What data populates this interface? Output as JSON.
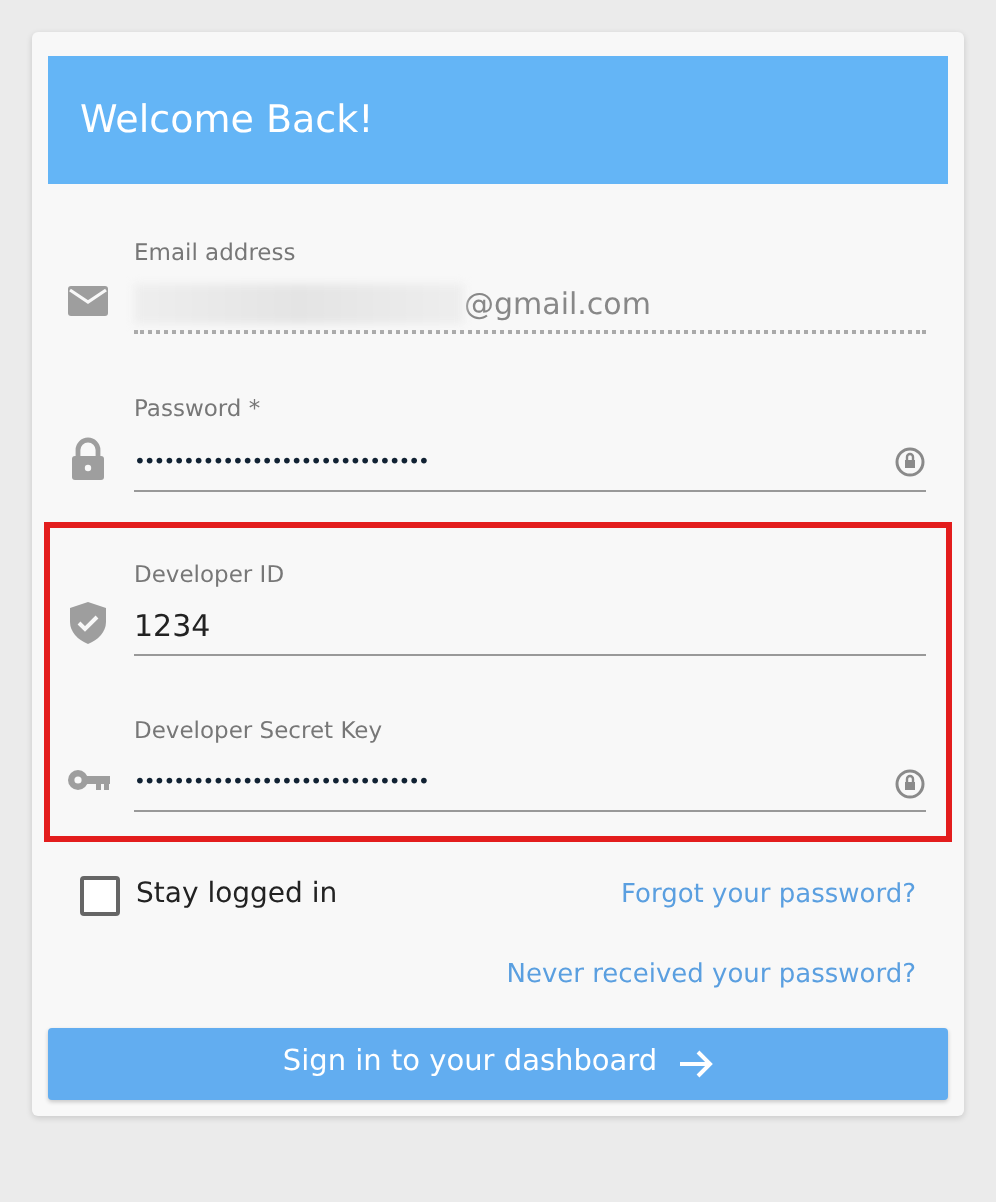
{
  "header": {
    "title": "Welcome Back!"
  },
  "sections": [
    {
      "highlighted": false,
      "fields": [
        {
          "kind": "email",
          "label": "Email address",
          "value": "@gmail.com",
          "redacted": true,
          "readonly": true,
          "reveal_toggle": false
        },
        {
          "kind": "lock",
          "label": "Password *",
          "value": "••••••••••••••••••••••••••••••",
          "redacted": false,
          "readonly": false,
          "reveal_toggle": true
        }
      ]
    },
    {
      "highlighted": true,
      "fields": [
        {
          "kind": "shield",
          "label": "Developer ID",
          "value": "1234",
          "redacted": false,
          "readonly": false,
          "reveal_toggle": false
        },
        {
          "kind": "key",
          "label": "Developer Secret Key",
          "value": "••••••••••••••••••••••••••••••",
          "redacted": false,
          "readonly": false,
          "reveal_toggle": true
        }
      ]
    }
  ],
  "stay_logged_in": {
    "label": "Stay logged in",
    "checked": false
  },
  "links": [
    "Forgot your password?",
    "Never received your password?"
  ],
  "submit": {
    "label": "Sign in to your dashboard"
  }
}
